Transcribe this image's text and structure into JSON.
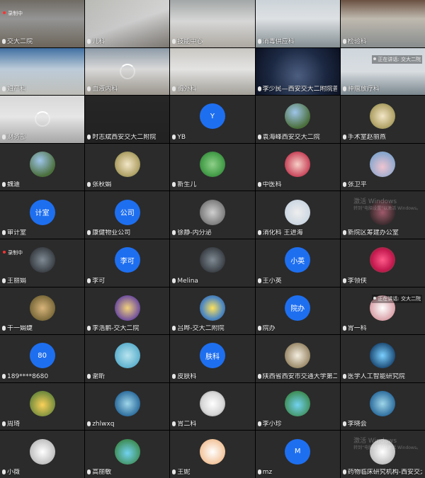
{
  "window": {
    "type": "video-conference-grid",
    "columns": 5,
    "rows": 10
  },
  "overlays": {
    "recording_label": "录制中",
    "speaking_label": "正在讲话: 交大二院",
    "windows_watermark": {
      "line1": "激活 Windows",
      "line2": "转到“电脑设置”以激活 Windows。"
    }
  },
  "tiles": [
    {
      "kind": "video",
      "style": "v1",
      "label": "交大二院",
      "overlay": "recording"
    },
    {
      "kind": "video",
      "style": "v2",
      "label": "儿科"
    },
    {
      "kind": "video",
      "style": "v3",
      "label": "技能中心"
    },
    {
      "kind": "video",
      "style": "v4",
      "label": "消毒供应科"
    },
    {
      "kind": "video",
      "style": "v5",
      "label": "检验科"
    },
    {
      "kind": "video",
      "style": "v6",
      "label": "妇产科"
    },
    {
      "kind": "video",
      "style": "v7",
      "label": "血液内科",
      "overlay": "spinner"
    },
    {
      "kind": "video",
      "style": "v8",
      "label": "胸外科"
    },
    {
      "kind": "video",
      "style": "v9",
      "label": "李少民—西安交大二附院普外科"
    },
    {
      "kind": "video",
      "style": "v10",
      "label": "肿瘤放疗科",
      "overlay": "speaking"
    },
    {
      "kind": "video",
      "style": "v11",
      "label": "财务部",
      "overlay": "spinner"
    },
    {
      "kind": "video",
      "style": "dark",
      "label": "时志斌西安交大二附院"
    },
    {
      "kind": "avatar",
      "color": "blue",
      "text": "Y",
      "label": "YB"
    },
    {
      "kind": "avatar",
      "style": "pic-a",
      "label": "袁海峰西安交大二院"
    },
    {
      "kind": "avatar",
      "style": "pic-b",
      "label": "手术室赵丽燕"
    },
    {
      "kind": "avatar",
      "style": "pic-a",
      "label": "魏迪"
    },
    {
      "kind": "avatar",
      "style": "pic-b",
      "label": "张秋娟"
    },
    {
      "kind": "avatar",
      "style": "pic-c",
      "label": "新生儿"
    },
    {
      "kind": "avatar",
      "style": "pic-d",
      "label": "中医科"
    },
    {
      "kind": "avatar",
      "style": "pic-e",
      "label": "张卫平"
    },
    {
      "kind": "avatar",
      "color": "blue",
      "text": "计室",
      "label": "审计室"
    },
    {
      "kind": "avatar",
      "color": "blue",
      "text": "公司",
      "label": "康健物业公司"
    },
    {
      "kind": "avatar",
      "style": "pic-f",
      "label": "徐静-内分泌"
    },
    {
      "kind": "avatar",
      "style": "pic-g",
      "label": "消化科 王进海"
    },
    {
      "kind": "avatar",
      "style": "pic-h",
      "label": "新院区筹建办公室",
      "overlay": "watermark"
    },
    {
      "kind": "avatar",
      "style": "pic-i",
      "label": "王丽娟",
      "overlay": "recording"
    },
    {
      "kind": "avatar",
      "color": "blue",
      "text": "李可",
      "label": "李可"
    },
    {
      "kind": "avatar",
      "style": "pic-i",
      "label": "Melina"
    },
    {
      "kind": "avatar",
      "color": "blue",
      "text": "小英",
      "label": "王小英"
    },
    {
      "kind": "avatar",
      "style": "pic-j",
      "label": "李领侠"
    },
    {
      "kind": "avatar",
      "style": "pic-k",
      "label": "干一娟婕"
    },
    {
      "kind": "avatar",
      "style": "pic-l",
      "label": "李浩鹏-交大二院"
    },
    {
      "kind": "avatar",
      "style": "pic-m",
      "label": "吕晔-交大二附院"
    },
    {
      "kind": "avatar",
      "color": "blue",
      "text": "院办",
      "label": "院办"
    },
    {
      "kind": "avatar",
      "style": "pic-n",
      "label": "胃一科",
      "overlay": "speaking"
    },
    {
      "kind": "avatar",
      "color": "blue",
      "text": "80",
      "label": "189****8680"
    },
    {
      "kind": "avatar",
      "style": "pic-o",
      "label": "谢昕"
    },
    {
      "kind": "avatar",
      "color": "blue",
      "text": "肤科",
      "label": "皮肤科"
    },
    {
      "kind": "avatar",
      "style": "pic-p",
      "label": "陕西省西安市交通大学第二附属..."
    },
    {
      "kind": "avatar",
      "style": "pic-q",
      "label": "医学人工智能研究院"
    },
    {
      "kind": "avatar",
      "style": "pic-r",
      "label": "周琦"
    },
    {
      "kind": "avatar",
      "style": "pic-s",
      "label": "zhlwxq"
    },
    {
      "kind": "avatar",
      "style": "pic-t",
      "label": "胃二科"
    },
    {
      "kind": "avatar",
      "style": "pic-u",
      "label": "李小珍"
    },
    {
      "kind": "avatar",
      "style": "pic-s",
      "label": "李晓会"
    },
    {
      "kind": "avatar",
      "style": "pic-w",
      "label": "小薇"
    },
    {
      "kind": "avatar",
      "style": "pic-u",
      "label": "高丽敏"
    },
    {
      "kind": "avatar",
      "style": "pic-v",
      "label": "王妮"
    },
    {
      "kind": "avatar",
      "color": "blue",
      "text": "M",
      "label": "mz"
    },
    {
      "kind": "avatar",
      "style": "pic-w",
      "label": "药物临床研究机构-西安交大二院",
      "overlay": "watermark"
    }
  ]
}
